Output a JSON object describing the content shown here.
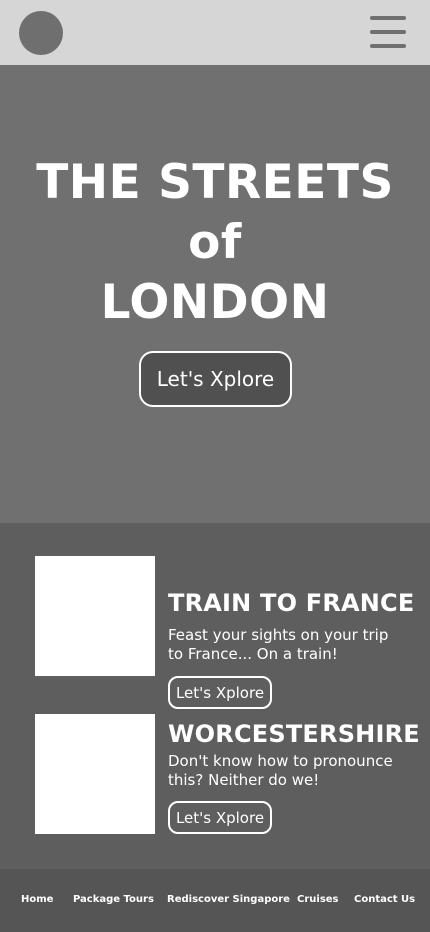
{
  "header": {
    "logo_icon": "circle-logo",
    "menu_icon": "hamburger-menu-icon"
  },
  "hero": {
    "title_line1": "THE STREETS",
    "title_line2": "of",
    "title_line3": "LONDON",
    "button_label": "Let's Xplore"
  },
  "cards": [
    {
      "title": "TRAIN TO FRANCE",
      "description": "Feast your sights on your trip to France... On a train!",
      "button_label": "Let's Xplore"
    },
    {
      "title": "WORCESTERSHIRE",
      "description": "Don't know how to pronounce this? Neither do we!",
      "button_label": "Let's Xplore"
    }
  ],
  "footer": {
    "links": [
      "Home",
      "Package Tours",
      "Rediscover Singapore",
      "Cruises",
      "Contact Us"
    ]
  },
  "colors": {
    "topbar": "#d6d6d6",
    "hero_bg": "#707070",
    "cards_bg": "#5e5e5e",
    "footer_bg": "#555555",
    "accent_text": "#ffffff"
  }
}
